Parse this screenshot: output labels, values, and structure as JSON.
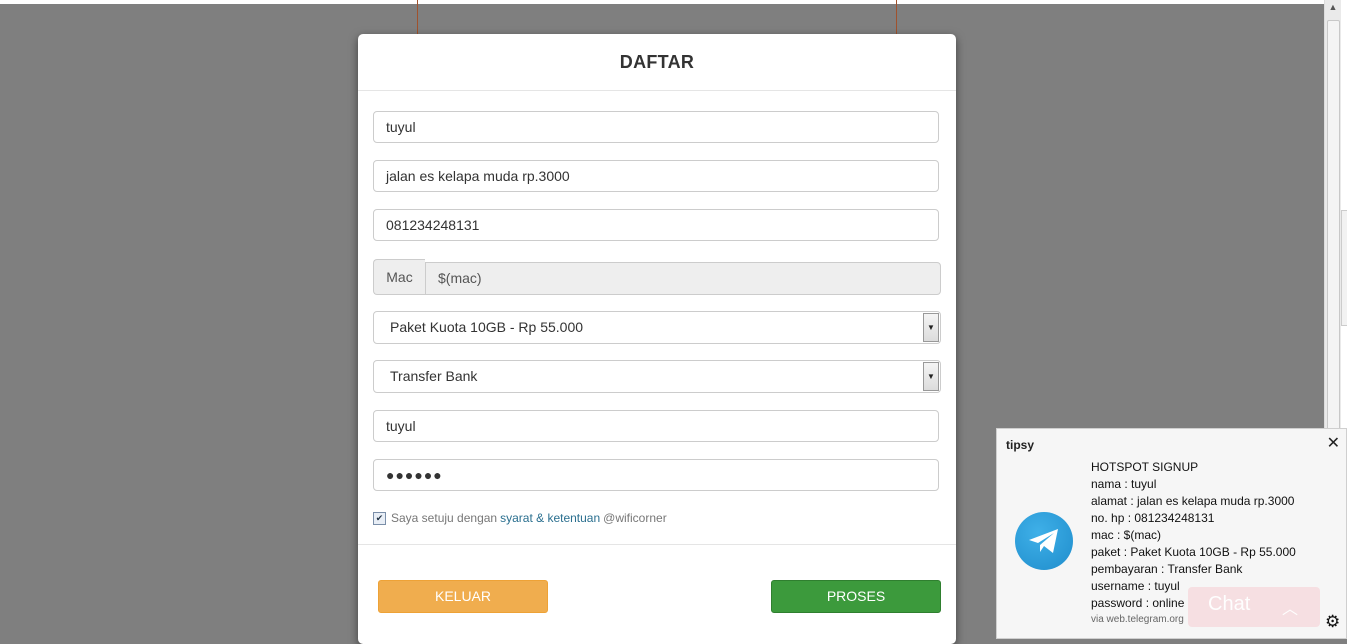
{
  "modal": {
    "title": "DAFTAR",
    "fields": {
      "nama": "tuyul",
      "alamat": "jalan es kelapa muda rp.3000",
      "hp": "081234248131",
      "mac_label": "Mac",
      "mac_value": "$(mac)",
      "paket": "Paket Kuota 10GB - Rp 55.000",
      "pembayaran": "Transfer Bank",
      "username": "tuyul",
      "password_masked": "●●●●●●"
    },
    "agree": {
      "checked": true,
      "text": "Saya setuju dengan",
      "link": "syarat & ketentuan",
      "suffix": "@wificorner"
    },
    "buttons": {
      "keluar": "KELUAR",
      "proses": "PROSES"
    }
  },
  "notification": {
    "source": "tipsy",
    "icon": "telegram-logo",
    "lines": [
      "HOTSPOT SIGNUP",
      "nama : tuyul",
      "alamat : jalan es kelapa muda rp.3000",
      "no. hp : 081234248131",
      "mac : $(mac)",
      "paket : Paket Kuota 10GB - Rp 55.000",
      "pembayaran : Transfer Bank",
      "username : tuyul",
      "password : online"
    ],
    "via": "via web.telegram.org",
    "close_icon": "✕"
  },
  "chat": {
    "label": "Chat",
    "chevron_icon": "chevron-up"
  },
  "settings_icon": "gear"
}
